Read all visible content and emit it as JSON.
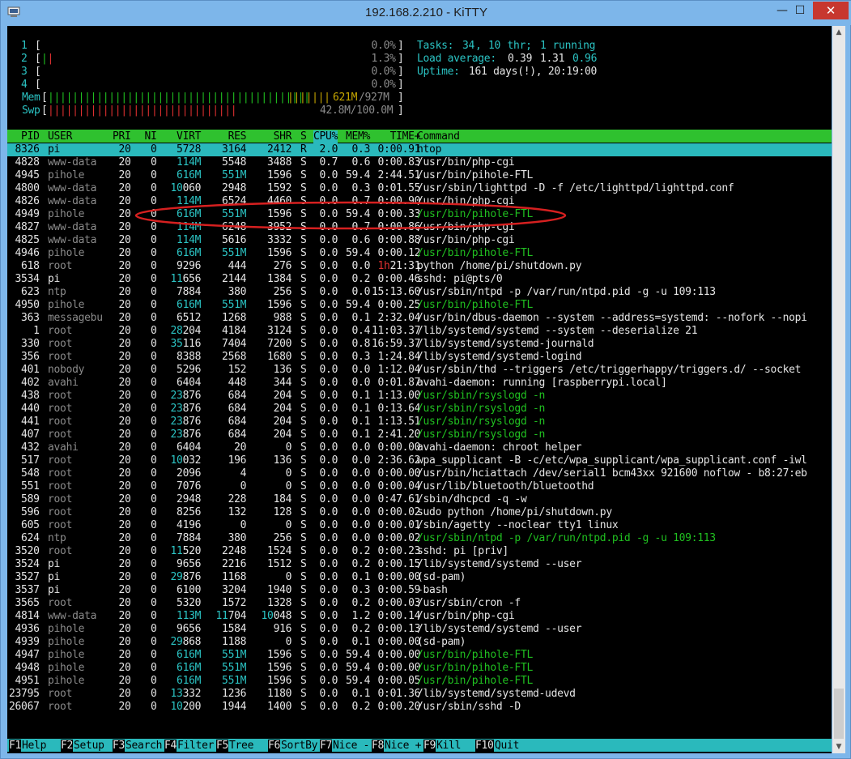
{
  "window": {
    "title": "192.168.2.210 - KiTTY",
    "close_glyph": "✕",
    "max_glyph": "☐",
    "min_glyph": "—"
  },
  "meters": {
    "cpus": [
      {
        "num": "1",
        "bar": "",
        "pct": "0.0%"
      },
      {
        "num": "2",
        "bar": "||",
        "pct": "1.3%"
      },
      {
        "num": "3",
        "bar": "",
        "pct": "0.0%"
      },
      {
        "num": "4",
        "bar": "",
        "pct": "0.0%"
      }
    ],
    "mem": {
      "label": "Mem",
      "bar": "|||||||||||||||||||||||||||||||||||||||||||",
      "bar_yellow": "|||||||",
      "value": "621M",
      "total": "/927M"
    },
    "swp": {
      "label": "Swp",
      "bar": "|||||||||||||||||||||||||||||||",
      "value": "42.8M/100.0M"
    }
  },
  "stats": {
    "tasks_label": "Tasks: ",
    "tasks": "34",
    "tasks_sep": ", ",
    "threads": "10",
    "thr_label": " thr; ",
    "running": "1",
    "running_label": " running",
    "load_label": "Load average: ",
    "load1": "0.39",
    "load5": "1.31",
    "load15": "0.96",
    "uptime_label": "Uptime: ",
    "uptime": "161 days(!), 20:19:00"
  },
  "table": {
    "columns": [
      "PID",
      "USER",
      "PRI",
      "NI",
      "VIRT",
      "RES",
      "SHR",
      "S",
      "CPU%",
      "MEM%",
      "TIME+",
      "Command"
    ],
    "rows": [
      [
        "8326",
        "pi",
        "20",
        "0",
        "5728",
        "3164",
        "2412",
        "R",
        "2.0",
        "0.3",
        "0:00.91",
        "htop"
      ],
      [
        "4828",
        "www-data",
        "20",
        "0",
        "114M",
        "5548",
        "3488",
        "S",
        "0.7",
        "0.6",
        "0:00.83",
        "/usr/bin/php-cgi"
      ],
      [
        "4945",
        "pihole",
        "20",
        "0",
        "616M",
        "551M",
        "1596",
        "S",
        "0.0",
        "59.4",
        "2:44.51",
        "/usr/bin/pihole-FTL"
      ],
      [
        "4800",
        "www-data",
        "20",
        "0",
        "10060",
        "2948",
        "1592",
        "S",
        "0.0",
        "0.3",
        "0:01.55",
        "/usr/sbin/lighttpd -D -f /etc/lighttpd/lighttpd.conf"
      ],
      [
        "4826",
        "www-data",
        "20",
        "0",
        "114M",
        "6524",
        "4460",
        "S",
        "0.0",
        "0.7",
        "0:00.90",
        "/usr/bin/php-cgi"
      ],
      [
        "4949",
        "pihole",
        "20",
        "0",
        "616M",
        "551M",
        "1596",
        "S",
        "0.0",
        "59.4",
        "0:00.33",
        "/usr/bin/pihole-FTL"
      ],
      [
        "4827",
        "www-data",
        "20",
        "0",
        "114M",
        "6248",
        "3952",
        "S",
        "0.0",
        "0.7",
        "0:00.86",
        "/usr/bin/php-cgi"
      ],
      [
        "4825",
        "www-data",
        "20",
        "0",
        "114M",
        "5616",
        "3332",
        "S",
        "0.0",
        "0.6",
        "0:00.88",
        "/usr/bin/php-cgi"
      ],
      [
        "4946",
        "pihole",
        "20",
        "0",
        "616M",
        "551M",
        "1596",
        "S",
        "0.0",
        "59.4",
        "0:00.12",
        "/usr/bin/pihole-FTL"
      ],
      [
        "618",
        "root",
        "20",
        "0",
        "9296",
        "444",
        "276",
        "S",
        "0.0",
        "0.0",
        "1h21:31",
        "python /home/pi/shutdown.py"
      ],
      [
        "3534",
        "pi",
        "20",
        "0",
        "11656",
        "2144",
        "1384",
        "S",
        "0.0",
        "0.2",
        "0:00.46",
        "sshd: pi@pts/0"
      ],
      [
        "623",
        "ntp",
        "20",
        "0",
        "7884",
        "380",
        "256",
        "S",
        "0.0",
        "0.0",
        "15:13.60",
        "/usr/sbin/ntpd -p /var/run/ntpd.pid -g -u 109:113"
      ],
      [
        "4950",
        "pihole",
        "20",
        "0",
        "616M",
        "551M",
        "1596",
        "S",
        "0.0",
        "59.4",
        "0:00.25",
        "/usr/bin/pihole-FTL"
      ],
      [
        "363",
        "messagebu",
        "20",
        "0",
        "6512",
        "1268",
        "988",
        "S",
        "0.0",
        "0.1",
        "2:32.04",
        "/usr/bin/dbus-daemon --system --address=systemd: --nofork --nopi"
      ],
      [
        "1",
        "root",
        "20",
        "0",
        "28204",
        "4184",
        "3124",
        "S",
        "0.0",
        "0.4",
        "11:03.37",
        "/lib/systemd/systemd --system --deserialize 21"
      ],
      [
        "330",
        "root",
        "20",
        "0",
        "35116",
        "7404",
        "7200",
        "S",
        "0.0",
        "0.8",
        "16:59.37",
        "/lib/systemd/systemd-journald"
      ],
      [
        "356",
        "root",
        "20",
        "0",
        "8388",
        "2568",
        "1680",
        "S",
        "0.0",
        "0.3",
        "1:24.84",
        "/lib/systemd/systemd-logind"
      ],
      [
        "401",
        "nobody",
        "20",
        "0",
        "5296",
        "152",
        "136",
        "S",
        "0.0",
        "0.0",
        "1:12.04",
        "/usr/sbin/thd --triggers /etc/triggerhappy/triggers.d/ --socket"
      ],
      [
        "402",
        "avahi",
        "20",
        "0",
        "6404",
        "448",
        "344",
        "S",
        "0.0",
        "0.0",
        "0:01.87",
        "avahi-daemon: running [raspberrypi.local]"
      ],
      [
        "438",
        "root",
        "20",
        "0",
        "23876",
        "684",
        "204",
        "S",
        "0.0",
        "0.1",
        "1:13.00",
        "/usr/sbin/rsyslogd -n"
      ],
      [
        "440",
        "root",
        "20",
        "0",
        "23876",
        "684",
        "204",
        "S",
        "0.0",
        "0.1",
        "0:13.64",
        "/usr/sbin/rsyslogd -n"
      ],
      [
        "441",
        "root",
        "20",
        "0",
        "23876",
        "684",
        "204",
        "S",
        "0.0",
        "0.1",
        "1:13.51",
        "/usr/sbin/rsyslogd -n"
      ],
      [
        "407",
        "root",
        "20",
        "0",
        "23876",
        "684",
        "204",
        "S",
        "0.0",
        "0.1",
        "2:41.20",
        "/usr/sbin/rsyslogd -n"
      ],
      [
        "432",
        "avahi",
        "20",
        "0",
        "6404",
        "20",
        "0",
        "S",
        "0.0",
        "0.0",
        "0:00.00",
        "avahi-daemon: chroot helper"
      ],
      [
        "517",
        "root",
        "20",
        "0",
        "10032",
        "196",
        "136",
        "S",
        "0.0",
        "0.0",
        "2:36.62",
        "wpa_supplicant -B -c/etc/wpa_supplicant/wpa_supplicant.conf -iwl"
      ],
      [
        "548",
        "root",
        "20",
        "0",
        "2096",
        "4",
        "0",
        "S",
        "0.0",
        "0.0",
        "0:00.00",
        "/usr/bin/hciattach /dev/serial1 bcm43xx 921600 noflow - b8:27:eb"
      ],
      [
        "551",
        "root",
        "20",
        "0",
        "7076",
        "0",
        "0",
        "S",
        "0.0",
        "0.0",
        "0:00.04",
        "/usr/lib/bluetooth/bluetoothd"
      ],
      [
        "589",
        "root",
        "20",
        "0",
        "2948",
        "228",
        "184",
        "S",
        "0.0",
        "0.0",
        "0:47.61",
        "/sbin/dhcpcd -q -w"
      ],
      [
        "596",
        "root",
        "20",
        "0",
        "8256",
        "132",
        "128",
        "S",
        "0.0",
        "0.0",
        "0:00.02",
        "sudo python /home/pi/shutdown.py"
      ],
      [
        "605",
        "root",
        "20",
        "0",
        "4196",
        "0",
        "0",
        "S",
        "0.0",
        "0.0",
        "0:00.01",
        "/sbin/agetty --noclear tty1 linux"
      ],
      [
        "624",
        "ntp",
        "20",
        "0",
        "7884",
        "380",
        "256",
        "S",
        "0.0",
        "0.0",
        "0:00.02",
        "/usr/sbin/ntpd -p /var/run/ntpd.pid -g -u 109:113"
      ],
      [
        "3520",
        "root",
        "20",
        "0",
        "11520",
        "2248",
        "1524",
        "S",
        "0.0",
        "0.2",
        "0:00.23",
        "sshd: pi [priv]"
      ],
      [
        "3524",
        "pi",
        "20",
        "0",
        "9656",
        "2216",
        "1512",
        "S",
        "0.0",
        "0.2",
        "0:00.15",
        "/lib/systemd/systemd --user"
      ],
      [
        "3527",
        "pi",
        "20",
        "0",
        "29876",
        "1168",
        "0",
        "S",
        "0.0",
        "0.1",
        "0:00.00",
        "(sd-pam)"
      ],
      [
        "3537",
        "pi",
        "20",
        "0",
        "6100",
        "3204",
        "1940",
        "S",
        "0.0",
        "0.3",
        "0:00.59",
        "-bash"
      ],
      [
        "3565",
        "root",
        "20",
        "0",
        "5320",
        "1572",
        "1328",
        "S",
        "0.0",
        "0.2",
        "0:00.03",
        "/usr/sbin/cron -f"
      ],
      [
        "4814",
        "www-data",
        "20",
        "0",
        "113M",
        "11704",
        "10048",
        "S",
        "0.0",
        "1.2",
        "0:00.14",
        "/usr/bin/php-cgi"
      ],
      [
        "4936",
        "pihole",
        "20",
        "0",
        "9656",
        "1584",
        "916",
        "S",
        "0.0",
        "0.2",
        "0:00.13",
        "/lib/systemd/systemd --user"
      ],
      [
        "4939",
        "pihole",
        "20",
        "0",
        "29868",
        "1188",
        "0",
        "S",
        "0.0",
        "0.1",
        "0:00.00",
        "(sd-pam)"
      ],
      [
        "4947",
        "pihole",
        "20",
        "0",
        "616M",
        "551M",
        "1596",
        "S",
        "0.0",
        "59.4",
        "0:00.00",
        "/usr/bin/pihole-FTL"
      ],
      [
        "4948",
        "pihole",
        "20",
        "0",
        "616M",
        "551M",
        "1596",
        "S",
        "0.0",
        "59.4",
        "0:00.00",
        "/usr/bin/pihole-FTL"
      ],
      [
        "4951",
        "pihole",
        "20",
        "0",
        "616M",
        "551M",
        "1596",
        "S",
        "0.0",
        "59.4",
        "0:00.05",
        "/usr/bin/pihole-FTL"
      ],
      [
        "23795",
        "root",
        "20",
        "0",
        "13332",
        "1236",
        "1180",
        "S",
        "0.0",
        "0.1",
        "0:01.36",
        "/lib/systemd/systemd-udevd"
      ],
      [
        "26067",
        "root",
        "20",
        "0",
        "10200",
        "1944",
        "1400",
        "S",
        "0.0",
        "0.2",
        "0:00.20",
        "/usr/sbin/sshd -D"
      ]
    ],
    "green_commands": [
      5,
      8,
      12,
      19,
      20,
      21,
      22,
      30,
      39,
      40,
      41
    ]
  },
  "footer": [
    {
      "key": "F1",
      "label": "Help  "
    },
    {
      "key": "F2",
      "label": "Setup "
    },
    {
      "key": "F3",
      "label": "Search"
    },
    {
      "key": "F4",
      "label": "Filter"
    },
    {
      "key": "F5",
      "label": "Tree  "
    },
    {
      "key": "F6",
      "label": "SortBy"
    },
    {
      "key": "F7",
      "label": "Nice -"
    },
    {
      "key": "F8",
      "label": "Nice +"
    },
    {
      "key": "F9",
      "label": "Kill  "
    },
    {
      "key": "F10",
      "label": "Quit"
    }
  ]
}
